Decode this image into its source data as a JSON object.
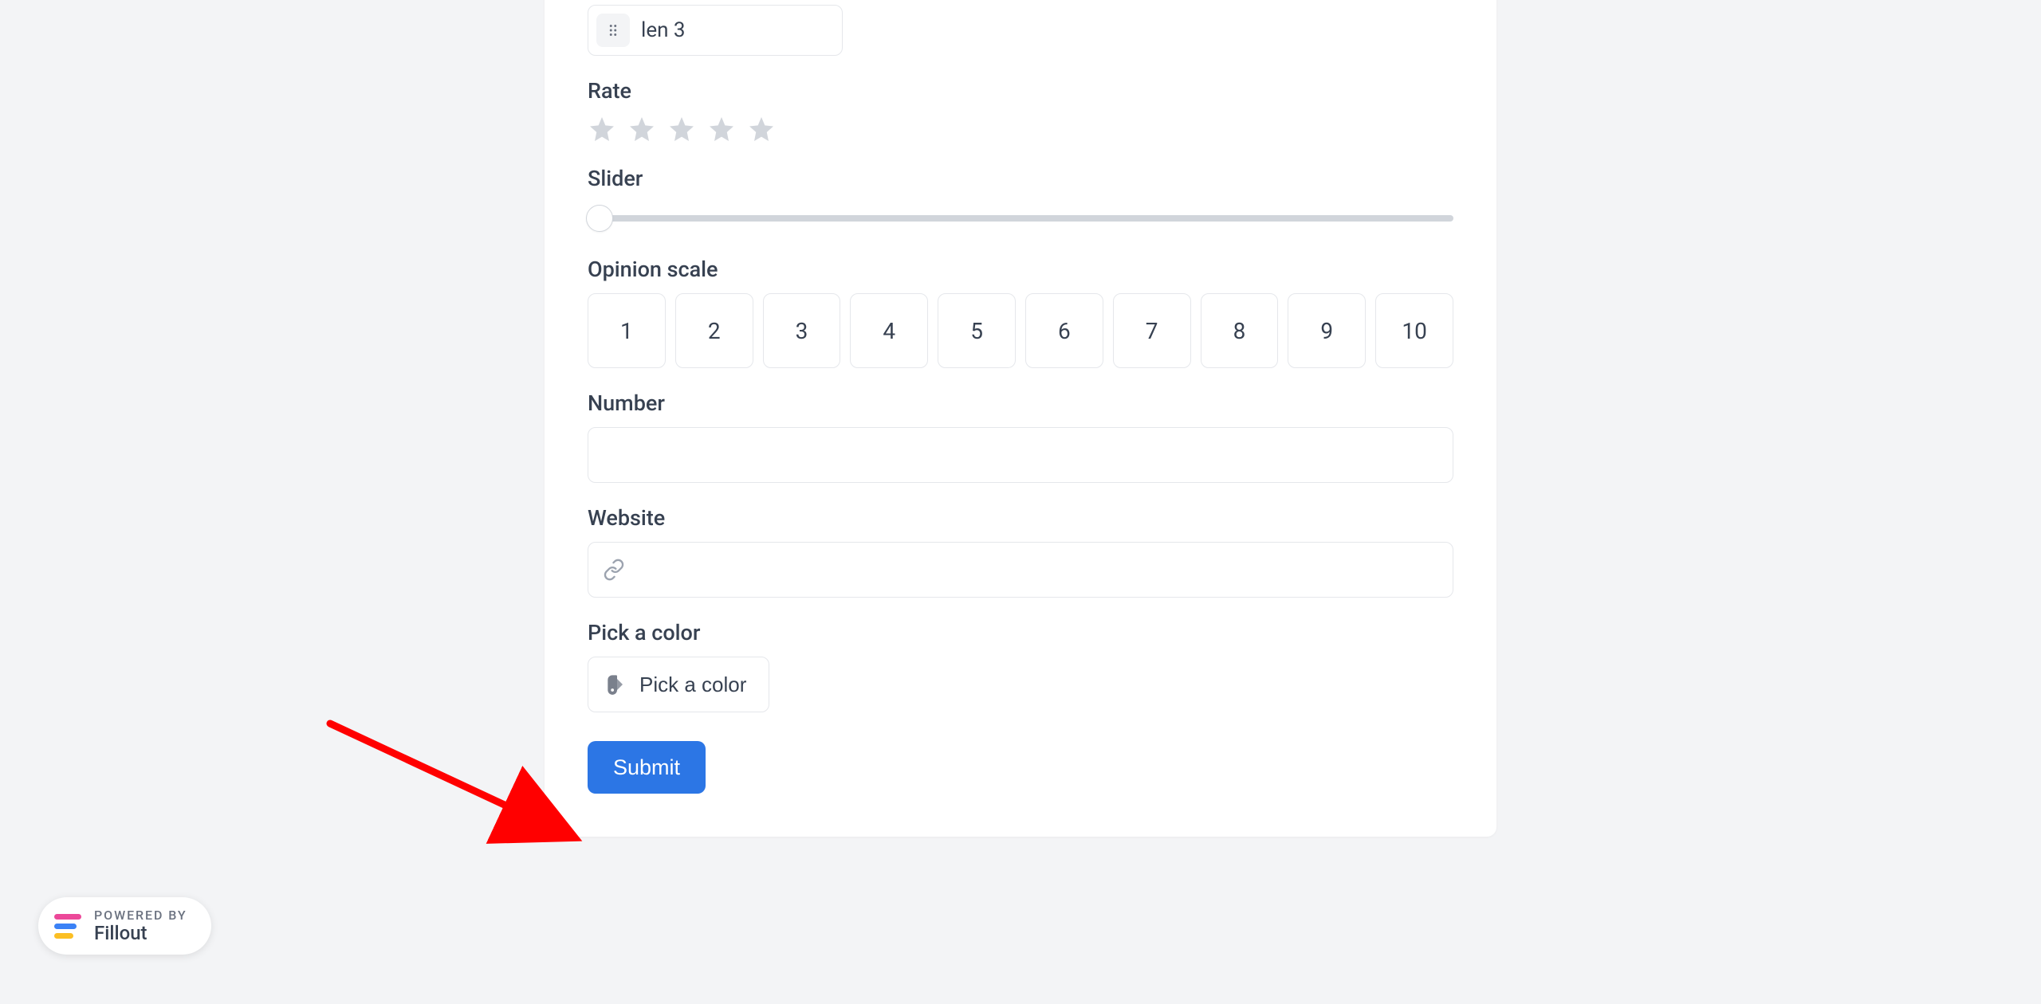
{
  "form": {
    "drag_item": {
      "label": "len 3"
    },
    "rate_label": "Rate",
    "slider_label": "Slider",
    "opinion_label": "Opinion scale",
    "opinion_values": [
      "1",
      "2",
      "3",
      "4",
      "5",
      "6",
      "7",
      "8",
      "9",
      "10"
    ],
    "number_label": "Number",
    "number_value": "",
    "website_label": "Website",
    "website_value": "",
    "color_label": "Pick a color",
    "color_button": "Pick a color",
    "submit_label": "Submit"
  },
  "badge": {
    "top": "POWERED BY",
    "bottom": "Fillout"
  },
  "colors": {
    "primary": "#2c76e5",
    "arrow": "#ff0000"
  }
}
